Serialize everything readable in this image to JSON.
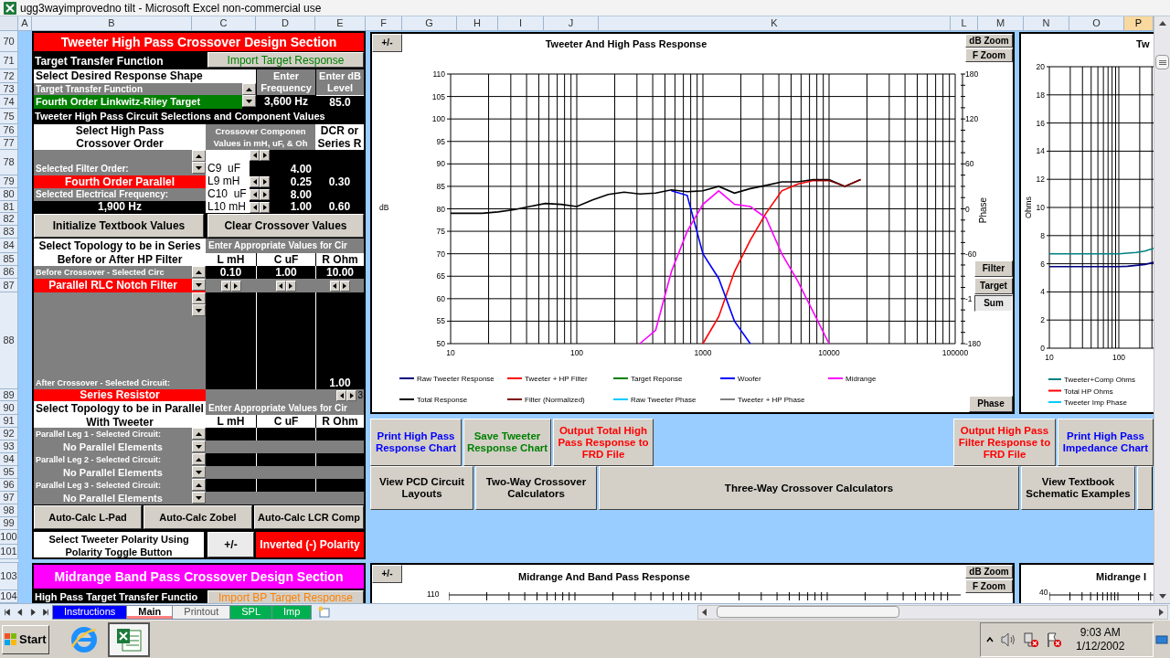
{
  "window": {
    "title": "ugg3wayimprovedno tilt - Microsoft Excel non-commercial use"
  },
  "columns": [
    {
      "label": "A",
      "selected": false
    },
    {
      "label": "B",
      "selected": false
    },
    {
      "label": "C",
      "selected": false
    },
    {
      "label": "D",
      "selected": false
    },
    {
      "label": "E",
      "selected": false
    },
    {
      "label": "F",
      "selected": false
    },
    {
      "label": "G",
      "selected": false
    },
    {
      "label": "H",
      "selected": false
    },
    {
      "label": "I",
      "selected": false
    },
    {
      "label": "J",
      "selected": false
    },
    {
      "label": "K",
      "selected": false
    },
    {
      "label": "L",
      "selected": false
    },
    {
      "label": "M",
      "selected": false
    },
    {
      "label": "N",
      "selected": false
    },
    {
      "label": "O",
      "selected": false
    },
    {
      "label": "P",
      "selected": true
    }
  ],
  "row_numbers": [
    "70",
    "71",
    "72",
    "73",
    "74",
    "75",
    "76",
    "77",
    "78",
    "79",
    "80",
    "81",
    "82",
    "83",
    "84",
    "85",
    "86",
    "87",
    "88",
    "89",
    "90",
    "91",
    "92",
    "93",
    "94",
    "95",
    "96",
    "97",
    "98",
    "99",
    "100",
    "101",
    "103",
    "104"
  ],
  "tweeter_section": {
    "title": "Tweeter High Pass Crossover Design Section",
    "target_label": "Target Transfer Function",
    "import_button": "Import Target Response",
    "shape_label": "Select Desired Response Shape",
    "transfer_label": "Target Transfer Function",
    "transfer_value": "Fourth Order Linkwitz-Riley Target",
    "frequency_header": "Enter Frequency",
    "level_header": "Enter dB Level",
    "frequency": "3,600 Hz",
    "level": "85.0",
    "circuit_heading": "Tweeter High Pass Circuit Selections and Component Values",
    "order_prompt": "Select High Pass Crossover Order",
    "component_header": [
      "Crossover Componen",
      "Values in mH, uF, & Oh"
    ],
    "dcr_header": "DCR or Series R",
    "filter_order_label": "Selected Filter Order:",
    "filter_order": "Fourth Order Parallel",
    "frequency_label": "Selected Electrical Frequency:",
    "electrical_frequency": "1,900 Hz",
    "components": [
      {
        "name": "C9  uF",
        "value": "4.00"
      },
      {
        "name": "L9 mH",
        "value": "0.25",
        "dcr": "0.30"
      },
      {
        "name": "C10  uF",
        "value": "8.00"
      },
      {
        "name": "L10 mH",
        "value": "1.00",
        "dcr": "0.60"
      }
    ],
    "buttons": [
      "Initialize Textbook Values",
      "Clear Crossover Values"
    ],
    "series_prompt": [
      "Select Topology to be in Series",
      "Before or After HP Filter"
    ],
    "values_header": "Enter Appropriate Values for Cir",
    "value_columns": [
      "L mH",
      "C uF",
      "R Ohm"
    ],
    "before_label": "Before Crossover - Selected Circ",
    "before_values": [
      "0.10",
      "1.00",
      "10.00"
    ],
    "before_circuit": "Parallel RLC Notch Filter",
    "after_label": "After Crossover - Selected Circuit:",
    "after_value": "1.00",
    "after_circuit": "Series Resistor",
    "edge_digit": "3",
    "parallel_prompt": [
      "Select Topology to be in Parallel",
      "With Tweeter"
    ],
    "parallel_values_header": "Enter Appropriate Values for Cir",
    "parallel_columns": [
      "L mH",
      "C uF",
      "R Ohm"
    ],
    "legs": [
      {
        "label": "Parallel Leg 1 - Selected Circuit:",
        "circuit": "No Parallel Elements"
      },
      {
        "label": "Parallel Leg 2 - Selected Circuit:",
        "circuit": "No Parallel Elements"
      },
      {
        "label": "Parallel Leg 3 - Selected Circuit:",
        "circuit": "No Parallel Elements"
      }
    ],
    "auto_buttons": [
      "Auto-Calc L-Pad",
      "Auto-Calc Zobel",
      "Auto-Calc LCR Comp"
    ],
    "polarity_prompt": "Select Tweeter Polarity Using Polarity Toggle Button",
    "polarity_button": "+/-",
    "polarity": "Inverted (-) Polarity"
  },
  "midrange_section": {
    "title": "Midrange Band Pass Crossover Design Section",
    "target_label": "High Pass Target Transfer Functio",
    "import_button": "Import BP Target Response"
  },
  "response_chart": {
    "toggle_button": "+/-",
    "zoom_buttons": [
      "dB Zoom",
      "F Zoom"
    ],
    "side_buttons": [
      {
        "label": "Filter",
        "selected": false
      },
      {
        "label": "Target",
        "selected": false
      },
      {
        "label": "Sum",
        "selected": true
      }
    ],
    "phase_button": "Phase",
    "phase_axis": {
      "label": "Phase",
      "ticks": [
        "180",
        "120",
        "60",
        "0",
        "-60",
        "-1",
        "-180"
      ]
    },
    "chart_data": {
      "type": "line",
      "title": "Tweeter And High Pass Response",
      "ylabel": "dB",
      "categories": [
        "10",
        null,
        null,
        null,
        null,
        null,
        null,
        null,
        "100",
        null,
        null,
        null,
        null,
        null,
        null,
        null,
        "1000",
        null,
        null,
        null,
        null,
        null,
        null,
        null,
        "10000",
        null,
        null,
        null,
        null,
        null,
        null,
        null,
        "100000"
      ],
      "series": [
        {
          "name": "Raw Tweeter Response",
          "color": "#000080",
          "values": [
            null,
            null,
            null,
            null,
            null,
            null,
            null,
            null,
            null,
            null,
            null,
            null,
            null,
            null,
            null,
            null,
            null,
            null,
            null,
            null,
            null,
            null,
            null,
            null,
            null,
            null,
            null,
            null,
            null,
            null,
            null,
            null,
            null
          ]
        },
        {
          "name": "Tweeter + HP Filter",
          "color": "#ff0000",
          "values": [
            null,
            null,
            null,
            null,
            null,
            null,
            null,
            null,
            null,
            null,
            null,
            null,
            null,
            null,
            null,
            null,
            50,
            56,
            66,
            73,
            79,
            84,
            85.5,
            86.3,
            86.3,
            null,
            null,
            null,
            null,
            null,
            null,
            null,
            null
          ]
        },
        {
          "name": "Target Reponse",
          "color": "#008000",
          "values": [
            null,
            null,
            null,
            null,
            null,
            null,
            null,
            null,
            null,
            null,
            null,
            null,
            null,
            null,
            null,
            null,
            null,
            null,
            null,
            null,
            null,
            null,
            null,
            null,
            null,
            null,
            null,
            null,
            null,
            null,
            null,
            null,
            null
          ]
        },
        {
          "name": "Woofer",
          "color": "#0000ff",
          "values": [
            null,
            null,
            null,
            null,
            null,
            null,
            null,
            null,
            null,
            null,
            null,
            null,
            null,
            null,
            84,
            83,
            70,
            64.5,
            55,
            50,
            null,
            null,
            null,
            null,
            null,
            null,
            null,
            null,
            null,
            null,
            null,
            null,
            null
          ]
        },
        {
          "name": "Midrange",
          "color": "#ff00ff",
          "values": [
            null,
            null,
            null,
            null,
            null,
            null,
            null,
            null,
            null,
            null,
            null,
            null,
            50,
            53,
            66,
            75,
            81,
            84,
            81,
            80.5,
            78,
            70,
            64,
            57,
            50,
            null,
            null,
            null,
            null,
            null,
            null,
            null,
            null
          ]
        },
        {
          "name": "Total Response",
          "color": "#000000",
          "values": [
            79,
            79,
            79,
            79.3,
            79.8,
            80.5,
            81.2,
            81,
            80.5,
            82,
            83.2,
            83.7,
            83.3,
            83.5,
            84.2,
            83.8,
            84,
            85,
            83.5,
            84.5,
            85.2,
            86,
            86,
            86.5,
            86.5,
            85,
            86.5,
            null,
            null,
            null,
            null,
            null,
            null
          ]
        },
        {
          "name": "Filter (Normalized)",
          "color": "#800000",
          "values": [
            null,
            null,
            null,
            null,
            null,
            null,
            null,
            null,
            null,
            null,
            null,
            null,
            null,
            null,
            null,
            null,
            null,
            null,
            null,
            null,
            null,
            null,
            null,
            86.3,
            86.3,
            85,
            86.5,
            null,
            null,
            null,
            null,
            null,
            null
          ]
        },
        {
          "name": "Raw Tweeter Phase",
          "color": "#00ccff",
          "values": [
            null,
            null,
            null,
            null,
            null,
            null,
            null,
            null,
            null,
            null,
            null,
            null,
            null,
            null,
            null,
            null,
            null,
            null,
            null,
            null,
            null,
            null,
            null,
            null,
            null,
            null,
            null,
            null,
            null,
            null,
            null,
            null,
            null
          ]
        },
        {
          "name": "Tweeter + HP Phase",
          "color": "#808080",
          "values": [
            null,
            null,
            null,
            null,
            null,
            null,
            null,
            null,
            null,
            null,
            null,
            null,
            null,
            null,
            null,
            null,
            null,
            null,
            null,
            null,
            null,
            null,
            null,
            null,
            null,
            null,
            null,
            null,
            null,
            null,
            null,
            null,
            null
          ]
        }
      ],
      "ylim": [
        50,
        110
      ],
      "yticks": [
        50,
        55,
        60,
        65,
        70,
        75,
        80,
        85,
        90,
        95,
        100,
        105,
        110
      ],
      "grid": true,
      "legend": "bottom"
    }
  },
  "impedance_chart": {
    "title": "Tw",
    "chart_data": {
      "type": "line",
      "ylabel": "Ohms",
      "categories": [
        "10",
        null,
        null,
        null,
        null,
        null,
        null,
        null,
        "100",
        null,
        null,
        null,
        null
      ],
      "series": [
        {
          "name": "Tweeter+Comp Ohms",
          "color": "#008080",
          "values": [
            6.7,
            6.7,
            6.7,
            6.7,
            6.7,
            6.7,
            6.7,
            6.7,
            6.7,
            6.75,
            6.8,
            6.9,
            7.1
          ]
        },
        {
          "name": "Total HP Ohms",
          "color": "#ff0000",
          "values": [
            null,
            null,
            null,
            null,
            null,
            null,
            null,
            null,
            null,
            null,
            null,
            null,
            null
          ]
        },
        {
          "name": "Tweeter Imp Phase",
          "color": "#00ccff",
          "values": [
            null,
            null,
            null,
            null,
            null,
            null,
            null,
            null,
            null,
            null,
            null,
            null,
            null
          ]
        },
        {
          "color": "#000080",
          "values": [
            5.8,
            5.8,
            5.8,
            5.8,
            5.8,
            5.8,
            5.8,
            5.8,
            5.8,
            5.82,
            5.88,
            5.95,
            6.1
          ]
        }
      ],
      "ylim": [
        0,
        20
      ],
      "yticks": [
        0,
        2,
        4,
        6,
        8,
        10,
        12,
        14,
        16,
        18,
        20
      ],
      "grid": true,
      "legend": "bottom"
    }
  },
  "action_buttons": {
    "left": [
      {
        "label": "Print High Pass Response Chart",
        "color": "#0000ff"
      },
      {
        "label": "Save Tweeter Response Chart",
        "color": "#008000"
      },
      {
        "label": "Output Total High Pass Response to FRD  File",
        "color": "#ff0000"
      }
    ],
    "right": [
      {
        "label": "Output High Pass Filter Response to FRD  File",
        "color": "#ff0000"
      },
      {
        "label": "Print High Pass Impedance Chart",
        "color": "#0000ff"
      }
    ]
  },
  "navigation_buttons": [
    "View PCD Circuit Layouts",
    "Two-Way Crossover Calculators",
    "Three-Way Crossover Calculators",
    "View Textbook Schematic Examples"
  ],
  "midrange_chart": {
    "toggle_button": "+/-",
    "title": "Midrange And Band Pass Response",
    "zoom_buttons": [
      "dB Zoom",
      "F Zoom"
    ],
    "top_tick": "110"
  },
  "midrange_impedance_chart": {
    "title": "Midrange I",
    "top_tick": "40"
  },
  "sheet_tabs": [
    {
      "label": "Instructions",
      "selected": false,
      "color": "#0000ff"
    },
    {
      "label": "Main",
      "selected": true,
      "color": "#ff8080"
    },
    {
      "label": "Printout",
      "selected": false
    },
    {
      "label": "SPL",
      "selected": false,
      "color": "#00b050"
    },
    {
      "label": "Imp",
      "selected": false,
      "color": "#00b050"
    }
  ],
  "taskbar": {
    "start": "Start",
    "time": "9:03 AM",
    "date": "1/12/2002"
  }
}
